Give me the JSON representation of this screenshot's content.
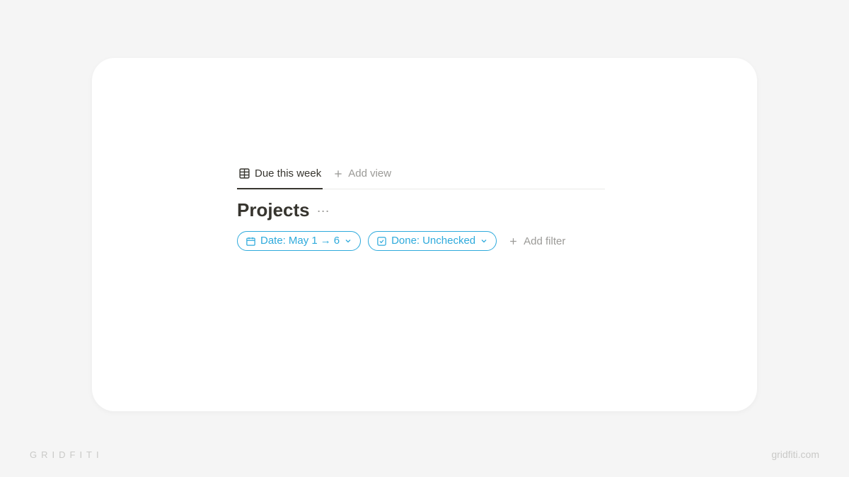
{
  "tabs": {
    "active": "Due this week",
    "add_view_label": "Add view"
  },
  "title": "Projects",
  "filters": [
    {
      "icon": "calendar",
      "label": "Date:",
      "value_start": "May 1",
      "value_end": "6"
    },
    {
      "icon": "checkbox",
      "label": "Done:",
      "value": "Unchecked"
    }
  ],
  "add_filter_label": "Add filter",
  "watermark": {
    "brand": "GRIDFITI",
    "url": "gridfiti.com"
  },
  "colors": {
    "accent": "#2eaadc",
    "text": "#37352f",
    "muted": "#9b9a97"
  }
}
